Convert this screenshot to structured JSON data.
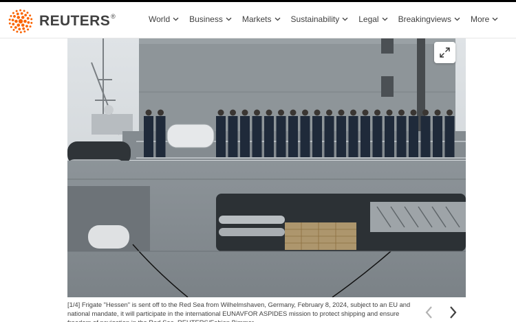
{
  "brand": {
    "name": "REUTERS",
    "reg_mark": "®",
    "color": "#fa6400"
  },
  "nav": {
    "items": [
      {
        "label": "World"
      },
      {
        "label": "Business"
      },
      {
        "label": "Markets"
      },
      {
        "label": "Sustainability"
      },
      {
        "label": "Legal"
      },
      {
        "label": "Breakingviews"
      },
      {
        "label": "More"
      }
    ]
  },
  "gallery": {
    "image_alt": "Frigate Hessen crew lined up on deck",
    "expand_icon": "expand-icon",
    "counter": "[1/4]",
    "caption": "Frigate \"Hessen\" is sent off to the Red Sea from Wilhelmshaven, Germany, February 8, 2024, subject to an EU and national mandate, it will participate in the international EUNAVFOR ASPIDES mission to protect shipping and ensure freedom of navigation in the Red Sea. REUTERS/Fabian Bimmer",
    "prev_icon": "chevron-left-icon",
    "next_icon": "chevron-right-icon"
  }
}
